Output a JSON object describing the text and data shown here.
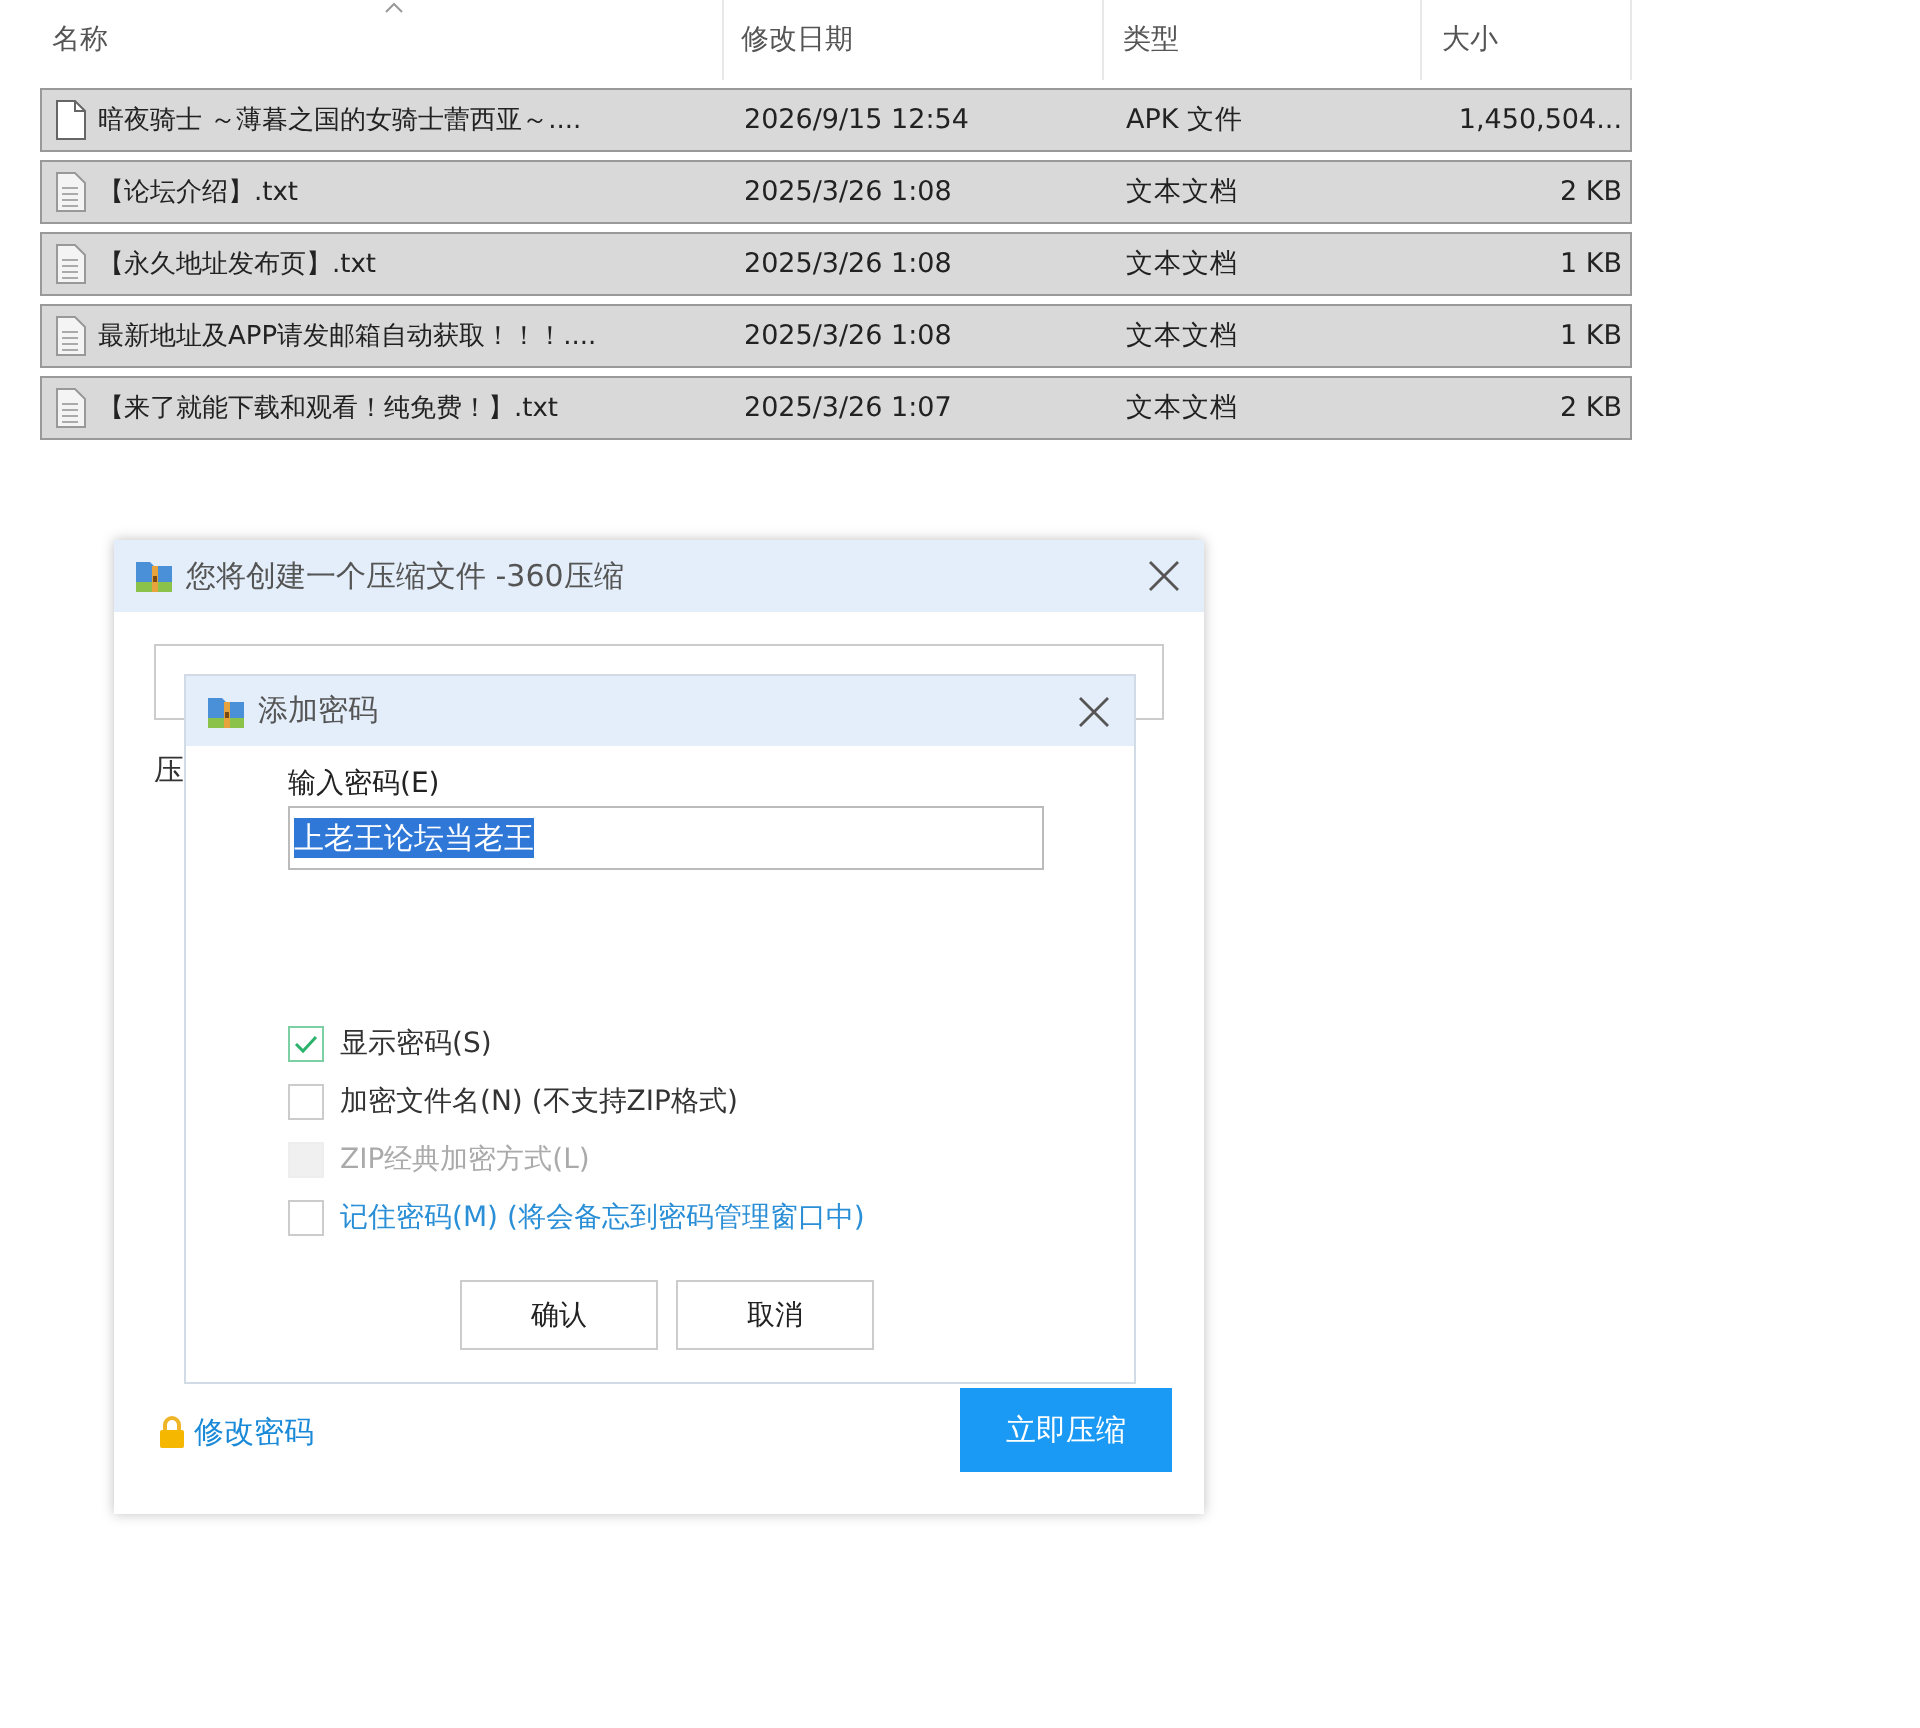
{
  "file_list": {
    "columns": [
      {
        "label": "名称",
        "sorted": true
      },
      {
        "label": "修改日期",
        "sorted": false
      },
      {
        "label": "类型",
        "sorted": false
      },
      {
        "label": "大小",
        "sorted": false
      }
    ],
    "rows": [
      {
        "kind": "apk",
        "name": "暗夜骑士 ～薄暮之国的女骑士蕾西亚～....",
        "date": "2026/9/15 12:54",
        "type": "APK 文件",
        "size": "1,450,504...",
        "selected": true
      },
      {
        "kind": "text",
        "name": "【论坛介绍】.txt",
        "date": "2025/3/26 1:08",
        "type": "文本文档",
        "size": "2 KB",
        "selected": true
      },
      {
        "kind": "text",
        "name": "【永久地址发布页】.txt",
        "date": "2025/3/26 1:08",
        "type": "文本文档",
        "size": "1 KB",
        "selected": true
      },
      {
        "kind": "text",
        "name": "最新地址及APP请发邮箱自动获取！！！....",
        "date": "2025/3/26 1:08",
        "type": "文本文档",
        "size": "1 KB",
        "selected": true
      },
      {
        "kind": "text",
        "name": "【来了就能下载和观看！纯免费！】.txt",
        "date": "2025/3/26 1:07",
        "type": "文本文档",
        "size": "2 KB",
        "selected": true
      }
    ]
  },
  "compress_dialog": {
    "title": "您将创建一个压缩文件 -360压缩",
    "label_fragment": "压",
    "change_password_link": "修改密码",
    "compress_button": "立即压缩"
  },
  "password_dialog": {
    "title": "添加密码",
    "password_label": "输入密码(E)",
    "password_value": "上老王论坛当老王",
    "options": [
      {
        "kind": "plain",
        "label": "显示密码(S)",
        "checked": true,
        "disabled": false
      },
      {
        "kind": "plain",
        "label": "加密文件名(N) (不支持ZIP格式)",
        "checked": false,
        "disabled": false
      },
      {
        "kind": "plain",
        "label": "ZIP经典加密方式(L)",
        "checked": false,
        "disabled": true
      },
      {
        "kind": "link",
        "label": "记住密码(M) (将会备忘到密码管理窗口中)",
        "checked": false,
        "disabled": false
      }
    ],
    "buttons": [
      "确认",
      "取消"
    ]
  }
}
